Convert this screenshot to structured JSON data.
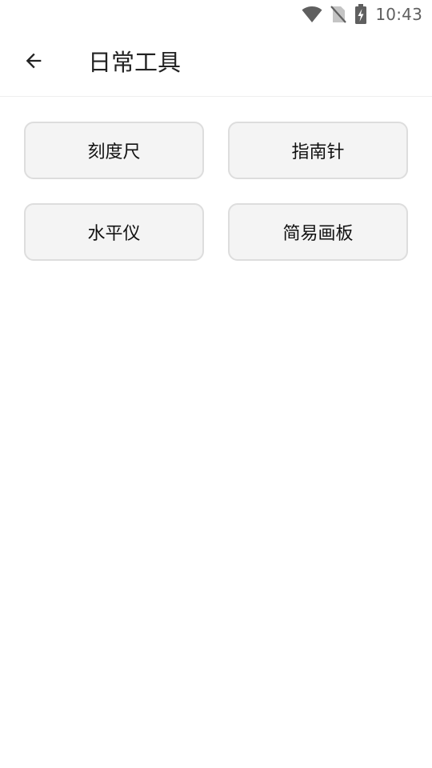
{
  "status_bar": {
    "time": "10:43",
    "icons": [
      "wifi-icon",
      "no-sim-icon",
      "battery-charging-icon"
    ]
  },
  "app_bar": {
    "back_icon": "arrow-left-icon",
    "title": "日常工具"
  },
  "tools": [
    {
      "label": "刻度尺"
    },
    {
      "label": "指南针"
    },
    {
      "label": "水平仪"
    },
    {
      "label": "简易画板"
    }
  ],
  "colors": {
    "background": "#ffffff",
    "button_bg": "#f4f4f4",
    "button_border": "#dddddd",
    "text": "#222222"
  }
}
